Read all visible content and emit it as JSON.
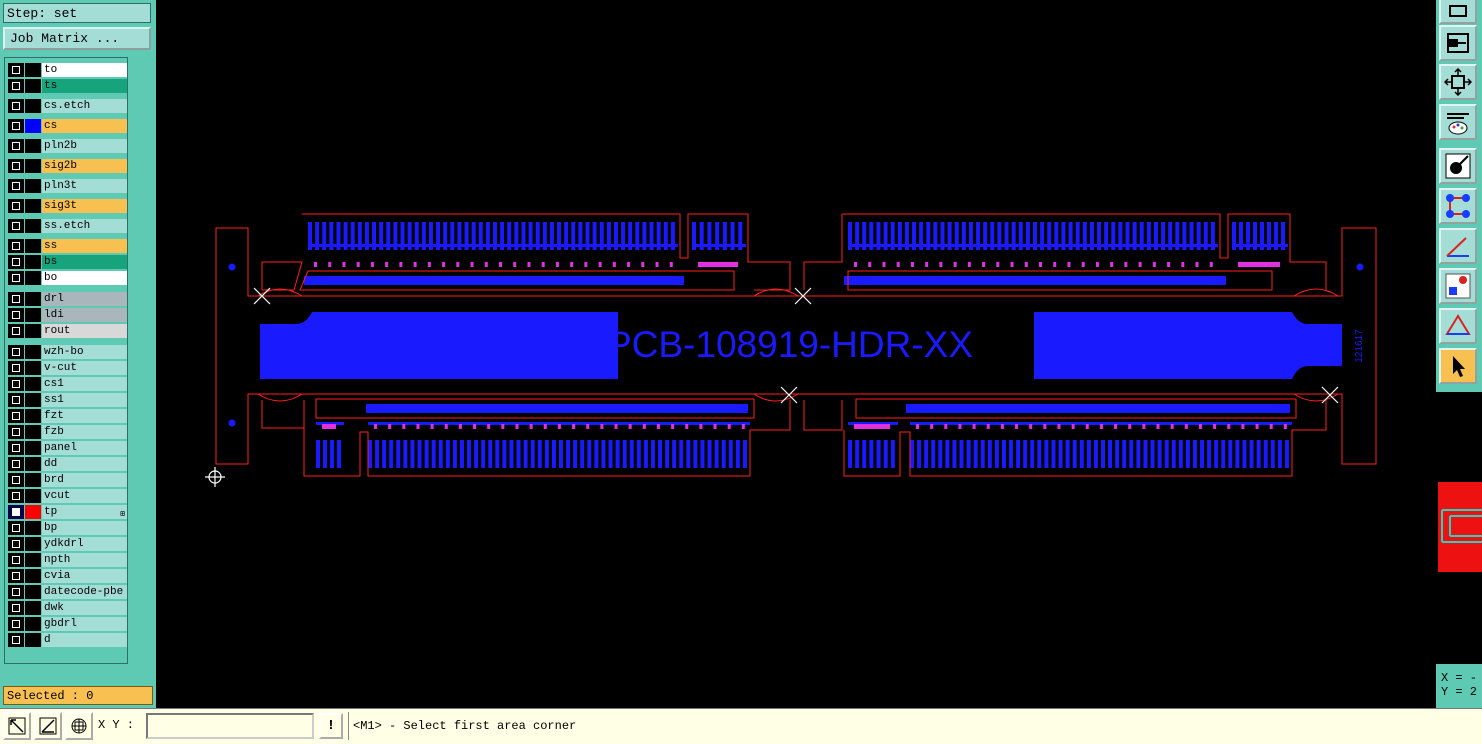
{
  "left_panel": {
    "step_label": "Step: set",
    "job_matrix_button": "Job Matrix ...",
    "selected_text": "Selected : 0"
  },
  "layers": [
    {
      "name": "to",
      "color": "#ffffff",
      "active": false,
      "swatch": "#000000",
      "flag": ""
    },
    {
      "name": "ts",
      "color": "#17a37c",
      "active": false,
      "swatch": "#000000",
      "flag": ""
    },
    {
      "name": "cs.etch",
      "color": "#a4dcd6",
      "active": false,
      "swatch": "#000000",
      "flag": ""
    },
    {
      "name": "cs",
      "color": "#f8c050",
      "active": false,
      "swatch": "#0000ff",
      "flag": ""
    },
    {
      "name": "pln2b",
      "color": "#a4dcd6",
      "active": false,
      "swatch": "#000000",
      "flag": ""
    },
    {
      "name": "sig2b",
      "color": "#f8c050",
      "active": false,
      "swatch": "#000000",
      "flag": ""
    },
    {
      "name": "pln3t",
      "color": "#a4dcd6",
      "active": false,
      "swatch": "#000000",
      "flag": ""
    },
    {
      "name": "sig3t",
      "color": "#f8c050",
      "active": false,
      "swatch": "#000000",
      "flag": ""
    },
    {
      "name": "ss.etch",
      "color": "#a4dcd6",
      "active": false,
      "swatch": "#000000",
      "flag": ""
    },
    {
      "name": "ss",
      "color": "#f8c050",
      "active": false,
      "swatch": "#000000",
      "flag": ""
    },
    {
      "name": "bs",
      "color": "#17a37c",
      "active": false,
      "swatch": "#000000",
      "flag": ""
    },
    {
      "name": "bo",
      "color": "#ffffff",
      "active": false,
      "swatch": "#000000",
      "flag": ""
    },
    {
      "name": "drl",
      "color": "#a9b7bc",
      "active": false,
      "swatch": "#000000",
      "flag": ""
    },
    {
      "name": "ldi",
      "color": "#a9b7bc",
      "active": false,
      "swatch": "#000000",
      "flag": ""
    },
    {
      "name": "rout",
      "color": "#d8d8d8",
      "active": false,
      "swatch": "#000000",
      "flag": ""
    },
    {
      "name": "wzh-bo",
      "color": "#a4dcd6",
      "active": false,
      "swatch": "#000000",
      "flag": ""
    },
    {
      "name": "v-cut",
      "color": "#a4dcd6",
      "active": false,
      "swatch": "#000000",
      "flag": ""
    },
    {
      "name": "cs1",
      "color": "#a4dcd6",
      "active": false,
      "swatch": "#000000",
      "flag": ""
    },
    {
      "name": "ss1",
      "color": "#a4dcd6",
      "active": false,
      "swatch": "#000000",
      "flag": ""
    },
    {
      "name": "fzt",
      "color": "#a4dcd6",
      "active": false,
      "swatch": "#000000",
      "flag": ""
    },
    {
      "name": "fzb",
      "color": "#a4dcd6",
      "active": false,
      "swatch": "#000000",
      "flag": ""
    },
    {
      "name": "panel",
      "color": "#a4dcd6",
      "active": false,
      "swatch": "#000000",
      "flag": ""
    },
    {
      "name": "dd",
      "color": "#a4dcd6",
      "active": false,
      "swatch": "#000000",
      "flag": ""
    },
    {
      "name": "brd",
      "color": "#a4dcd6",
      "active": false,
      "swatch": "#000000",
      "flag": ""
    },
    {
      "name": "vcut",
      "color": "#a4dcd6",
      "active": false,
      "swatch": "#000000",
      "flag": ""
    },
    {
      "name": "tp",
      "color": "#a4dcd6",
      "active": true,
      "swatch": "#ff0000",
      "flag": "⊞"
    },
    {
      "name": "bp",
      "color": "#a4dcd6",
      "active": false,
      "swatch": "#000000",
      "flag": ""
    },
    {
      "name": "ydkdrl",
      "color": "#a4dcd6",
      "active": false,
      "swatch": "#000000",
      "flag": ""
    },
    {
      "name": "npth",
      "color": "#a4dcd6",
      "active": false,
      "swatch": "#000000",
      "flag": ""
    },
    {
      "name": "cvia",
      "color": "#a4dcd6",
      "active": false,
      "swatch": "#000000",
      "flag": ""
    },
    {
      "name": "datecode-pbe",
      "color": "#a4dcd6",
      "active": false,
      "swatch": "#000000",
      "flag": ""
    },
    {
      "name": "dwk",
      "color": "#a4dcd6",
      "active": false,
      "swatch": "#000000",
      "flag": ""
    },
    {
      "name": "gbdrl",
      "color": "#a4dcd6",
      "active": false,
      "swatch": "#000000",
      "flag": ""
    },
    {
      "name": "d",
      "color": "#a4dcd6",
      "active": false,
      "swatch": "#000000",
      "flag": ""
    }
  ],
  "canvas": {
    "board_text": "PCB-108919-HDR-XX",
    "side_text": "121617",
    "outline_color": "#ff2020",
    "copper_color": "#1a1aff",
    "pad_color": "#e030e0",
    "background": "#000000"
  },
  "right_toolbar": {
    "icons": [
      "zoom-fit-icon",
      "pan-frame-icon",
      "resize-arrows-icon",
      "tools-palette-icon",
      "snap-point-icon",
      "connect-nodes-icon",
      "measure-angle-icon",
      "drc-marker-icon",
      "triangle-measure-icon",
      "pointer-select-icon"
    ],
    "coords_x": "X = -",
    "coords_y": "Y = 2"
  },
  "bottom_bar": {
    "xy_label": "X Y :",
    "xy_value": "",
    "bang_label": "!",
    "prompt": "<M1> - Select first area corner"
  }
}
